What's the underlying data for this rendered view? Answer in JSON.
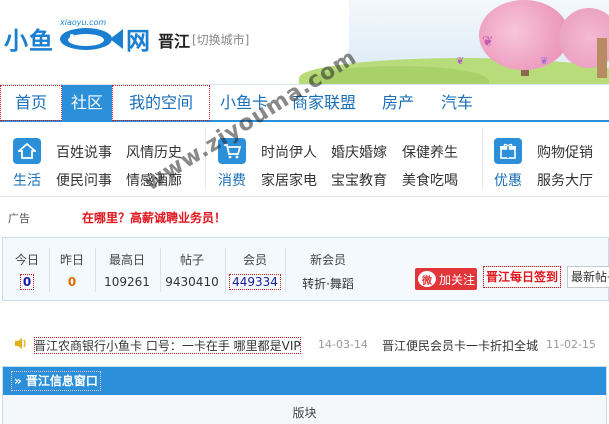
{
  "header": {
    "logo_left": "小鱼",
    "logo_right": "网",
    "logo_url": "xiaoyu.com",
    "city": "晋江",
    "switch_city": "[切换城市]"
  },
  "nav": {
    "items": [
      "首页",
      "社区",
      "我的空间",
      "小鱼卡",
      "商家联盟",
      "房产",
      "汽车"
    ],
    "active": "社区"
  },
  "categories": {
    "groups": [
      {
        "icon": "home-icon",
        "title": "生活",
        "links": [
          "百姓说事",
          "风情历史",
          "便民问事",
          "情感酒廊"
        ]
      },
      {
        "icon": "cart-icon",
        "title": "消费",
        "links": [
          "时尚伊人",
          "婚庆婚嫁",
          "保健养生",
          "家居家电",
          "宝宝教育",
          "美食吃喝"
        ]
      },
      {
        "icon": "gift-icon",
        "title": "优惠",
        "links": [
          "购物促销",
          "服务大厅"
        ]
      }
    ]
  },
  "ad": {
    "label": "广告",
    "text": "在哪里？高薪诚聘业务员！"
  },
  "stats": {
    "labels": [
      "今日",
      "昨日",
      "最高日",
      "帖子",
      "会员",
      "新会员"
    ],
    "values": [
      "0",
      "0",
      "109261",
      "9430410",
      "449334",
      "转折·舞蹈"
    ],
    "follow_label": "加关注",
    "sign_label": "晋江每日签到",
    "newpost_label": "最新帖子"
  },
  "ticker": {
    "items": [
      {
        "text": "晋江农商银行小鱼卡 口号：一卡在手 哪里都是VIP",
        "date": "14-03-14"
      },
      {
        "text": "晋江便民会员卡一卡折扣全城",
        "date": "11-02-15"
      }
    ]
  },
  "window": {
    "title": "» 晋江信息窗口",
    "body": "版块"
  },
  "watermark": "www.ziyouma.com",
  "colors": {
    "brand_blue": "#2b8fd9",
    "red": "#e0151d",
    "stat_blue": "#1a1aa0",
    "stat_orange": "#e06a00"
  }
}
